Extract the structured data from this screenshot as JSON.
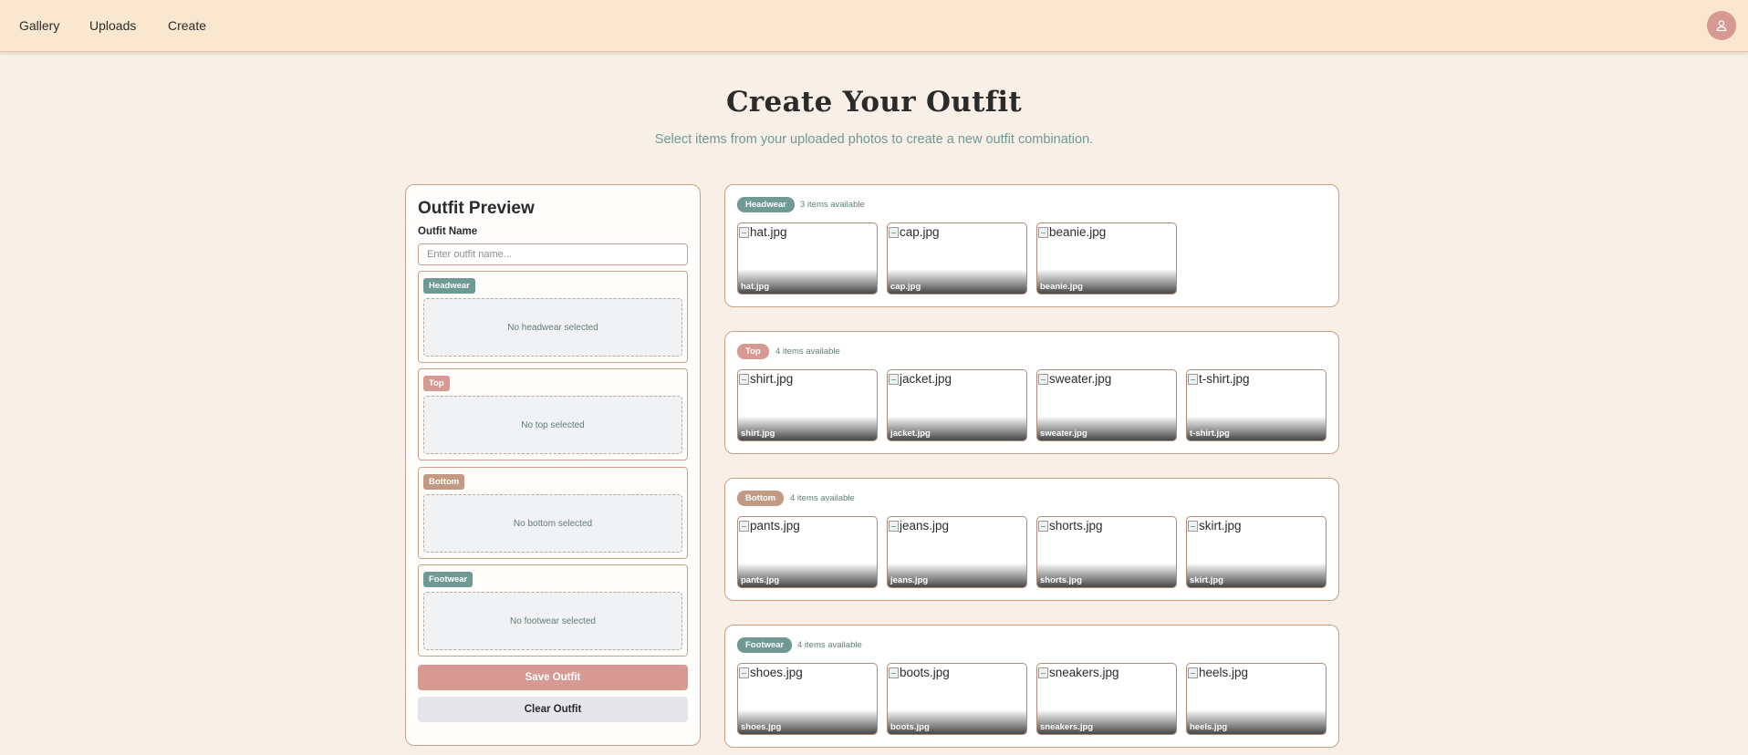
{
  "nav": {
    "links": [
      {
        "label": "Gallery"
      },
      {
        "label": "Uploads"
      },
      {
        "label": "Create"
      }
    ],
    "avatar_icon": "user-icon"
  },
  "header": {
    "title": "Create Your Outfit",
    "subtitle": "Select items from your uploaded photos to create a new outfit combination."
  },
  "preview": {
    "title": "Outfit Preview",
    "name_label": "Outfit Name",
    "name_placeholder": "Enter outfit name...",
    "name_value": "",
    "slots": [
      {
        "badge": "Headwear",
        "empty_text": "No headwear selected",
        "color": "#6e9a93"
      },
      {
        "badge": "Top",
        "empty_text": "No top selected",
        "color": "#d69a92"
      },
      {
        "badge": "Bottom",
        "empty_text": "No bottom selected",
        "color": "#c29a84"
      },
      {
        "badge": "Footwear",
        "empty_text": "No footwear selected",
        "color": "#6e9a93"
      }
    ],
    "save_label": "Save Outfit",
    "clear_label": "Clear Outfit"
  },
  "categories": [
    {
      "badge": "Headwear",
      "color": "#6e9a93",
      "count_text": "3 items available",
      "items": [
        {
          "alt": "hat.jpg",
          "caption": "hat.jpg"
        },
        {
          "alt": "cap.jpg",
          "caption": "cap.jpg"
        },
        {
          "alt": "beanie.jpg",
          "caption": "beanie.jpg"
        }
      ]
    },
    {
      "badge": "Top",
      "color": "#d69a92",
      "count_text": "4 items available",
      "items": [
        {
          "alt": "shirt.jpg",
          "caption": "shirt.jpg"
        },
        {
          "alt": "jacket.jpg",
          "caption": "jacket.jpg"
        },
        {
          "alt": "sweater.jpg",
          "caption": "sweater.jpg"
        },
        {
          "alt": "t-shirt.jpg",
          "caption": "t-shirt.jpg"
        }
      ]
    },
    {
      "badge": "Bottom",
      "color": "#c29a84",
      "count_text": "4 items available",
      "items": [
        {
          "alt": "pants.jpg",
          "caption": "pants.jpg"
        },
        {
          "alt": "jeans.jpg",
          "caption": "jeans.jpg"
        },
        {
          "alt": "shorts.jpg",
          "caption": "shorts.jpg"
        },
        {
          "alt": "skirt.jpg",
          "caption": "skirt.jpg"
        }
      ]
    },
    {
      "badge": "Footwear",
      "color": "#6e9a93",
      "count_text": "4 items available",
      "items": [
        {
          "alt": "shoes.jpg",
          "caption": "shoes.jpg"
        },
        {
          "alt": "boots.jpg",
          "caption": "boots.jpg"
        },
        {
          "alt": "sneakers.jpg",
          "caption": "sneakers.jpg"
        },
        {
          "alt": "heels.jpg",
          "caption": "heels.jpg"
        }
      ]
    }
  ]
}
